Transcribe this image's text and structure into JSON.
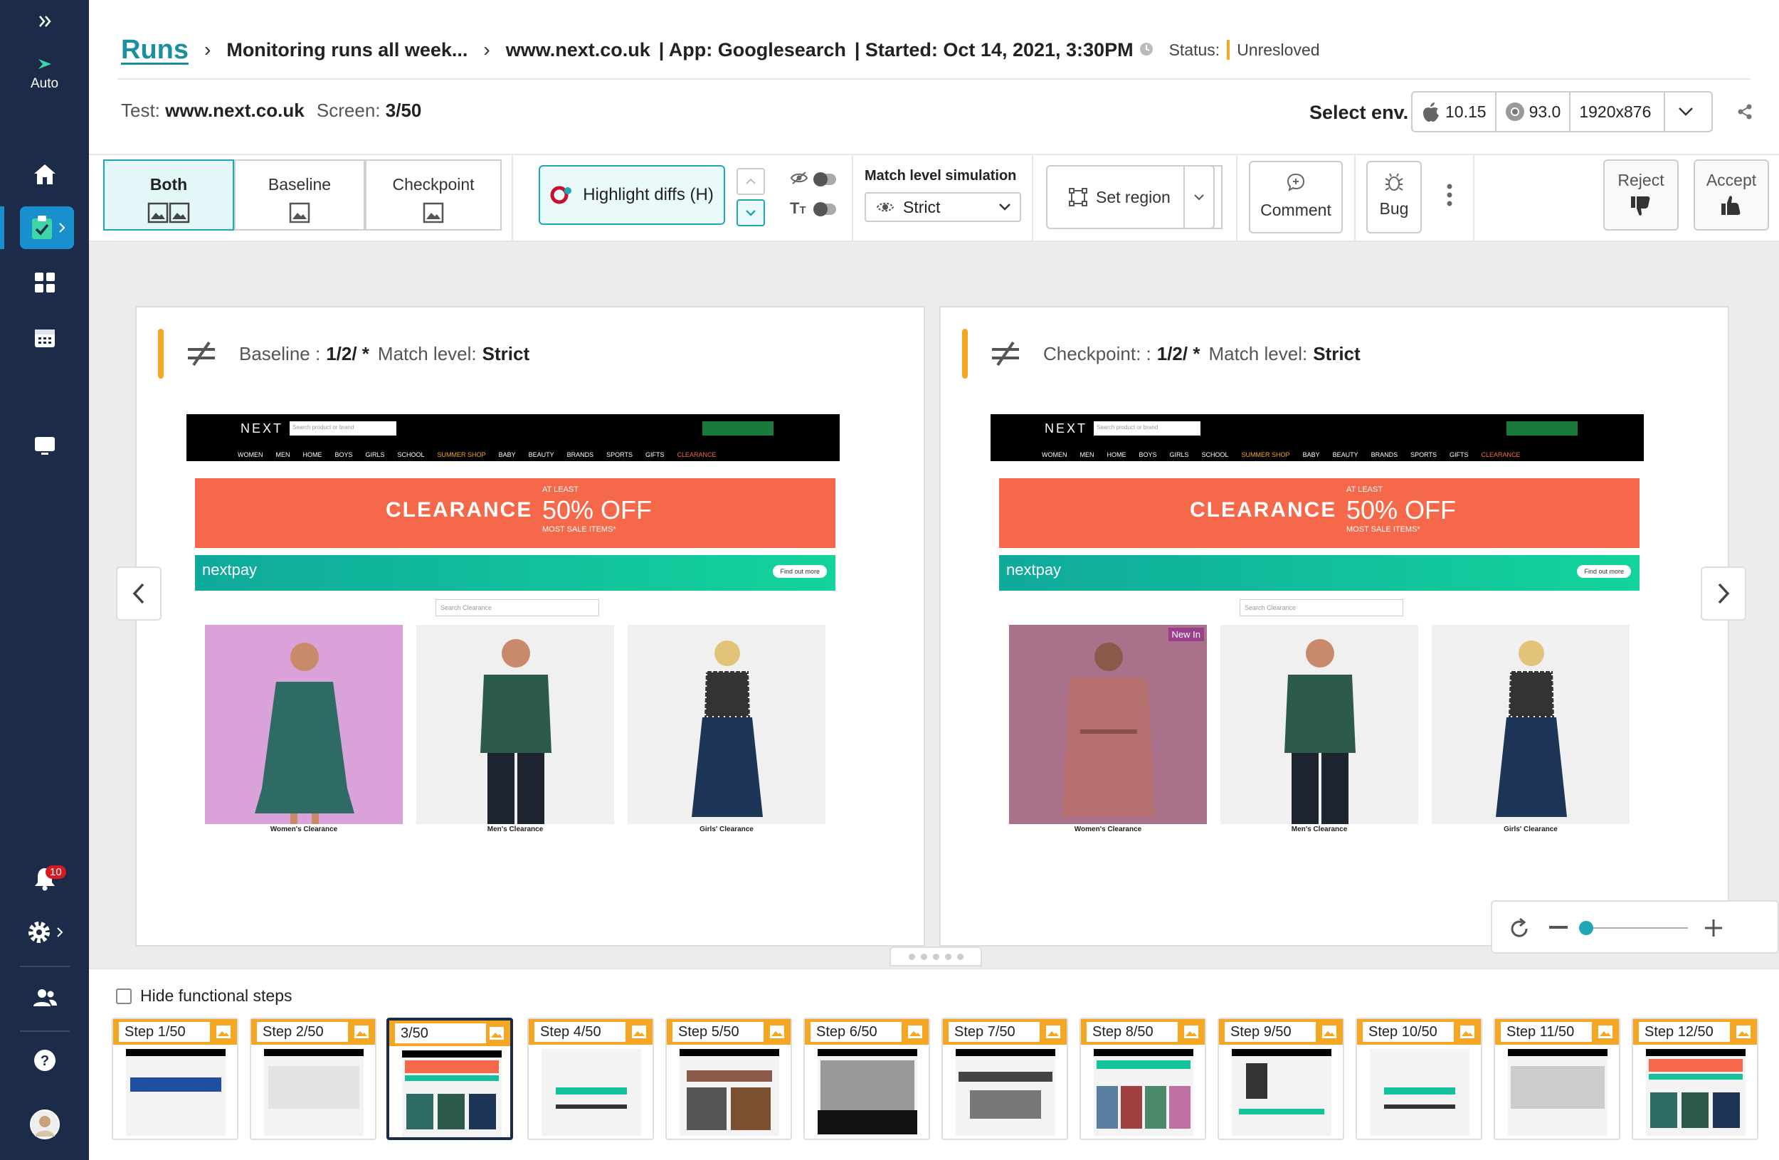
{
  "sidebar": {
    "auto_label": "Auto",
    "notification_count": "10"
  },
  "breadcrumb": {
    "root": "Runs",
    "level1": "Monitoring runs all week...",
    "level2": "www.next.co.uk",
    "app": "| App: Googlesearch",
    "started": "| Started: Oct 14, 2021, 3:30PM",
    "status_label": "Status:",
    "status_value": "Unresloved"
  },
  "test_info": {
    "test_label": "Test:",
    "test_value": "www.next.co.uk",
    "screen_label": "Screen:",
    "screen_value": "3/50"
  },
  "env": {
    "label": "Select env.",
    "os_version": "10.15",
    "browser_version": "93.0",
    "resolution": "1920x876"
  },
  "toolbar": {
    "view_both": "Both",
    "view_baseline": "Baseline",
    "view_checkpoint": "Checkpoint",
    "highlight": "Highlight diffs (H)",
    "match_sim_label": "Match level simulation",
    "match_sim_value": "Strict",
    "set_region": "Set region",
    "comment": "Comment",
    "bug": "Bug",
    "reject": "Reject",
    "accept": "Accept"
  },
  "panels": {
    "baseline": {
      "label": "Baseline :",
      "step": "1/2/ *",
      "match_label": "Match level:",
      "match_value": "Strict"
    },
    "checkpoint": {
      "label": "Checkpoint: :",
      "step": "1/2/ *",
      "match_label": "Match level:",
      "match_value": "Strict"
    }
  },
  "site": {
    "logo": "NEXT",
    "search_placeholder": "Search product or brand",
    "nav": [
      "WOMEN",
      "MEN",
      "HOME",
      "BOYS",
      "GIRLS",
      "SCHOOL",
      "SUMMER SHOP",
      "BABY",
      "BEAUTY",
      "BRANDS",
      "SPORTS",
      "GIFTS",
      "CLEARANCE"
    ],
    "banner_title": "CLEARANCE",
    "banner_at_least": "AT LEAST",
    "banner_off": "50% OFF",
    "banner_sub": "MOST SALE ITEMS*",
    "pay_logo": "nextpay",
    "pay_btn": "Find out more",
    "search_clearance": "Search Clearance",
    "new_in": "New In",
    "products": [
      "Women's Clearance",
      "Men's Clearance",
      "Girls' Clearance"
    ]
  },
  "bottom": {
    "hide_functional": "Hide functional steps",
    "steps": [
      "Step 1/50",
      "Step 2/50",
      "3/50",
      "Step 4/50",
      "Step 5/50",
      "Step 6/50",
      "Step 7/50",
      "Step 8/50",
      "Step 9/50",
      "Step 10/50",
      "Step 11/50",
      "Step 12/50"
    ]
  },
  "colors": {
    "sidebar_bg": "#1c2b47",
    "accent_teal": "#1a8fa0",
    "status_orange": "#f5a623",
    "banner_orange": "#f5694a"
  }
}
